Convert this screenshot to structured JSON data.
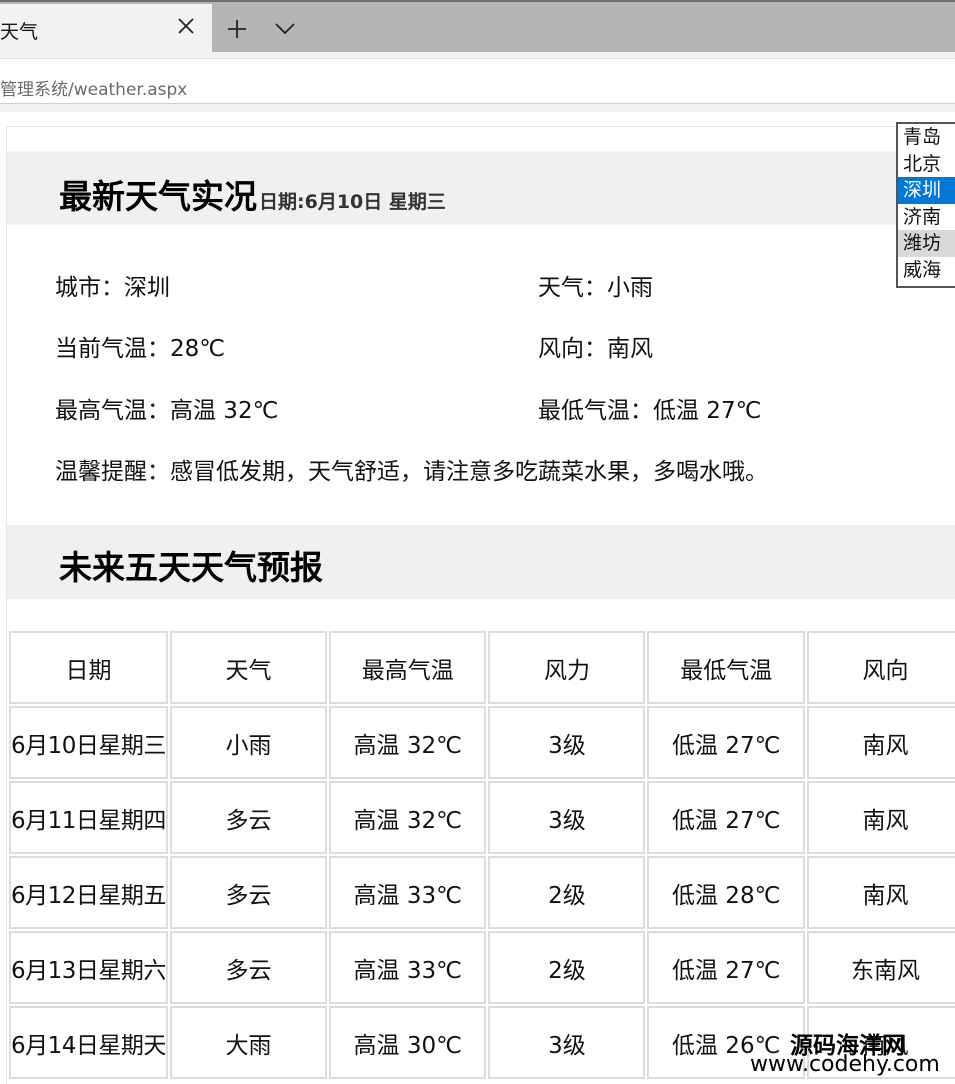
{
  "browser": {
    "tab_title": "天气",
    "address": "管理系统/weather.aspx"
  },
  "current": {
    "heading": "最新天气实况",
    "date": "日期:6月10日 星期三",
    "city_label": "城市：",
    "city_value": "深圳",
    "weather_label": "天气：",
    "weather_value": "小雨",
    "temp_label": "当前气温：",
    "temp_value": "28℃",
    "wind_dir_label": "风向：",
    "wind_dir_value": "南风",
    "high_label": "最高气温：",
    "high_value": "高温 32℃",
    "low_label": "最低气温：",
    "low_value": "低温 27℃",
    "tip_label": "温馨提醒：",
    "tip_value": "感冒低发期，天气舒适，请注意多吃蔬菜水果，多喝水哦。"
  },
  "forecast": {
    "heading": "未来五天天气预报",
    "headers": [
      "日期",
      "天气",
      "最高气温",
      "风力",
      "最低气温",
      "风向"
    ],
    "rows": [
      [
        "6月10日星期三",
        "小雨",
        "高温 32℃",
        "3级",
        "低温 27℃",
        "南风"
      ],
      [
        "6月11日星期四",
        "多云",
        "高温 32℃",
        "3级",
        "低温 27℃",
        "南风"
      ],
      [
        "6月12日星期五",
        "多云",
        "高温 33℃",
        "2级",
        "低温 28℃",
        "南风"
      ],
      [
        "6月13日星期六",
        "多云",
        "高温 33℃",
        "2级",
        "低温 27℃",
        "东南风"
      ],
      [
        "6月14日星期天",
        "大雨",
        "高温 30℃",
        "3级",
        "低温 26℃",
        "南风"
      ]
    ]
  },
  "cities": {
    "items": [
      "青岛",
      "北京",
      "深圳",
      "济南",
      "潍坊",
      "威海"
    ],
    "selected": "深圳",
    "hovered": "潍坊"
  },
  "watermark": {
    "line1": "源码海洋网",
    "line2": "www.codehy.com"
  },
  "colors": {
    "selected_bg": "#0078d7",
    "banner_bg": "#f0f0f0",
    "cell_border": "#dcdcdc"
  }
}
